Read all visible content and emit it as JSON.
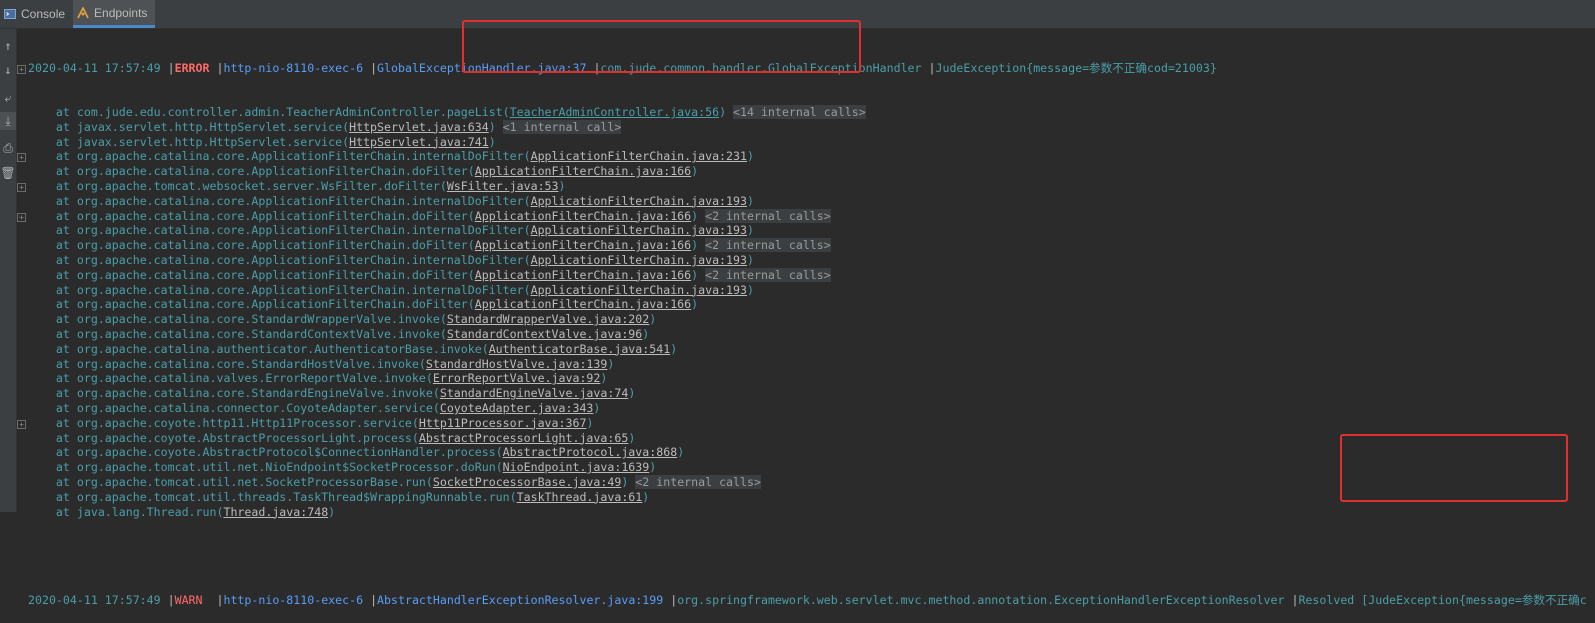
{
  "tabs": [
    {
      "label": "Console",
      "active": false,
      "icon": "console-icon"
    },
    {
      "label": "Endpoints",
      "active": true,
      "icon": "endpoints-icon"
    }
  ],
  "log1": {
    "timestamp": "2020-04-11 17:57:49",
    "level": "ERROR",
    "thread": "http-nio-8110-exec-6",
    "source": "GlobalExceptionHandler.java:37",
    "logger": "com.jude.common.handler.GlobalExceptionHandler",
    "message": "JudeException{message=参数不正确cod=21003}"
  },
  "stack": [
    {
      "method": "com.jude.edu.controller.admin.TeacherAdminController.pageList",
      "loc": "TeacherAdminController.java:56",
      "internal": "<14 internal calls>",
      "fold": false,
      "projectFrame": true
    },
    {
      "method": "javax.servlet.http.HttpServlet.service",
      "loc": "HttpServlet.java:634",
      "internal": "<1 internal call>",
      "fold": true
    },
    {
      "method": "javax.servlet.http.HttpServlet.service",
      "loc": "HttpServlet.java:741",
      "internal": "",
      "fold": false
    },
    {
      "method": "org.apache.catalina.core.ApplicationFilterChain.internalDoFilter",
      "loc": "ApplicationFilterChain.java:231",
      "internal": "",
      "fold": false
    },
    {
      "method": "org.apache.catalina.core.ApplicationFilterChain.doFilter",
      "loc": "ApplicationFilterChain.java:166",
      "internal": "",
      "fold": false
    },
    {
      "method": "org.apache.tomcat.websocket.server.WsFilter.doFilter",
      "loc": "WsFilter.java:53",
      "internal": "",
      "fold": false
    },
    {
      "method": "org.apache.catalina.core.ApplicationFilterChain.internalDoFilter",
      "loc": "ApplicationFilterChain.java:193",
      "internal": "",
      "fold": false
    },
    {
      "method": "org.apache.catalina.core.ApplicationFilterChain.doFilter",
      "loc": "ApplicationFilterChain.java:166",
      "internal": "<2 internal calls>",
      "fold": true
    },
    {
      "method": "org.apache.catalina.core.ApplicationFilterChain.internalDoFilter",
      "loc": "ApplicationFilterChain.java:193",
      "internal": "",
      "fold": false
    },
    {
      "method": "org.apache.catalina.core.ApplicationFilterChain.doFilter",
      "loc": "ApplicationFilterChain.java:166",
      "internal": "<2 internal calls>",
      "fold": true
    },
    {
      "method": "org.apache.catalina.core.ApplicationFilterChain.internalDoFilter",
      "loc": "ApplicationFilterChain.java:193",
      "internal": "",
      "fold": false
    },
    {
      "method": "org.apache.catalina.core.ApplicationFilterChain.doFilter",
      "loc": "ApplicationFilterChain.java:166",
      "internal": "<2 internal calls>",
      "fold": true
    },
    {
      "method": "org.apache.catalina.core.ApplicationFilterChain.internalDoFilter",
      "loc": "ApplicationFilterChain.java:193",
      "internal": "",
      "fold": false
    },
    {
      "method": "org.apache.catalina.core.ApplicationFilterChain.doFilter",
      "loc": "ApplicationFilterChain.java:166",
      "internal": "",
      "fold": false
    },
    {
      "method": "org.apache.catalina.core.StandardWrapperValve.invoke",
      "loc": "StandardWrapperValve.java:202",
      "internal": "",
      "fold": false
    },
    {
      "method": "org.apache.catalina.core.StandardContextValve.invoke",
      "loc": "StandardContextValve.java:96",
      "internal": "",
      "fold": false
    },
    {
      "method": "org.apache.catalina.authenticator.AuthenticatorBase.invoke",
      "loc": "AuthenticatorBase.java:541",
      "internal": "",
      "fold": false
    },
    {
      "method": "org.apache.catalina.core.StandardHostValve.invoke",
      "loc": "StandardHostValve.java:139",
      "internal": "",
      "fold": false
    },
    {
      "method": "org.apache.catalina.valves.ErrorReportValve.invoke",
      "loc": "ErrorReportValve.java:92",
      "internal": "",
      "fold": false
    },
    {
      "method": "org.apache.catalina.core.StandardEngineValve.invoke",
      "loc": "StandardEngineValve.java:74",
      "internal": "",
      "fold": false
    },
    {
      "method": "org.apache.catalina.connector.CoyoteAdapter.service",
      "loc": "CoyoteAdapter.java:343",
      "internal": "",
      "fold": false
    },
    {
      "method": "org.apache.coyote.http11.Http11Processor.service",
      "loc": "Http11Processor.java:367",
      "internal": "",
      "fold": false
    },
    {
      "method": "org.apache.coyote.AbstractProcessorLight.process",
      "loc": "AbstractProcessorLight.java:65",
      "internal": "",
      "fold": false
    },
    {
      "method": "org.apache.coyote.AbstractProtocol$ConnectionHandler.process",
      "loc": "AbstractProtocol.java:868",
      "internal": "",
      "fold": false
    },
    {
      "method": "org.apache.tomcat.util.net.NioEndpoint$SocketProcessor.doRun",
      "loc": "NioEndpoint.java:1639",
      "internal": "",
      "fold": false
    },
    {
      "method": "org.apache.tomcat.util.net.SocketProcessorBase.run",
      "loc": "SocketProcessorBase.java:49",
      "internal": "<2 internal calls>",
      "fold": true
    },
    {
      "method": "org.apache.tomcat.util.threads.TaskThread$WrappingRunnable.run",
      "loc": "TaskThread.java:61",
      "internal": "",
      "fold": false
    },
    {
      "method": "java.lang.Thread.run",
      "loc": "Thread.java:748",
      "internal": "",
      "fold": false
    }
  ],
  "log2": {
    "timestamp": "2020-04-11 17:57:49",
    "level": "WARN",
    "thread": "http-nio-8110-exec-6",
    "source": "AbstractHandlerExceptionResolver.java:199",
    "logger": "org.springframework.web.servlet.mvc.method.annotation.ExceptionHandlerExceptionResolver",
    "resolved": "Resolved",
    "message": "[JudeException{message=参数不正确c"
  },
  "at_keyword": "at",
  "separator": "|",
  "colors": {
    "background": "#2b2b2b",
    "stack_teal": "#4a9ea8",
    "error_red": "#ff6b68",
    "highlight_box": "#e03030"
  }
}
